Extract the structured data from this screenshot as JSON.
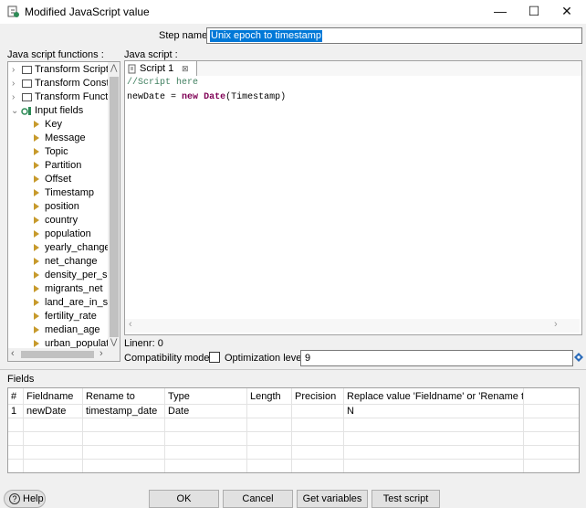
{
  "window": {
    "title": "Modified JavaScript value",
    "minimize_glyph": "—",
    "maximize_glyph": "☐",
    "close_glyph": "✕"
  },
  "step": {
    "label": "Step name",
    "value": "Unix epoch to timestamp"
  },
  "functions_panel": {
    "label": "Java script functions :",
    "folders": [
      {
        "label": "Transform Scripts"
      },
      {
        "label": "Transform Constan"
      },
      {
        "label": "Transform Functior"
      },
      {
        "label": "Input fields"
      }
    ],
    "fields": [
      {
        "label": "Key"
      },
      {
        "label": "Message"
      },
      {
        "label": "Topic"
      },
      {
        "label": "Partition"
      },
      {
        "label": "Offset"
      },
      {
        "label": "Timestamp"
      },
      {
        "label": "position"
      },
      {
        "label": "country"
      },
      {
        "label": "population"
      },
      {
        "label": "yearly_change"
      },
      {
        "label": "net_change"
      },
      {
        "label": "density_per_squ"
      },
      {
        "label": "migrants_net"
      },
      {
        "label": "land_are_in_squ"
      },
      {
        "label": "fertility_rate"
      },
      {
        "label": "median_age"
      },
      {
        "label": "urban_populatic"
      }
    ]
  },
  "script_panel": {
    "label": "Java script :",
    "tab_label": "Script 1",
    "code_comment": "//Script here",
    "code_var": "newDate",
    "code_eq": " = ",
    "code_new": "new",
    "code_date": "Date",
    "code_arg": "(Timestamp)",
    "linenr": "Linenr: 0"
  },
  "options": {
    "compat_label": "Compatibility mode?",
    "compat_checked": false,
    "opt_label": "Optimization level",
    "opt_value": "9"
  },
  "fields_grid": {
    "label": "Fields",
    "headers": [
      "#",
      "Fieldname",
      "Rename to",
      "Type",
      "Length",
      "Precision",
      "Replace value 'Fieldname' or 'Rename to'"
    ],
    "rows": [
      [
        "1",
        "newDate",
        "timestamp_date",
        "Date",
        "",
        "",
        "N"
      ]
    ]
  },
  "buttons": {
    "help": "Help",
    "ok": "OK",
    "cancel": "Cancel",
    "get_variables": "Get variables",
    "test_script": "Test script"
  },
  "colors": {
    "selection": "#0078d7",
    "comment": "#3f7f5f",
    "keyword": "#7f0055",
    "field_triangle": "#c79a2c",
    "input_fields_icon": "#2e8b57"
  }
}
